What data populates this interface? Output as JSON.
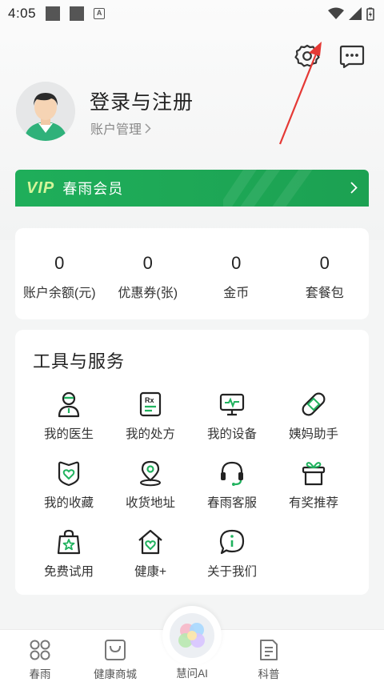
{
  "status_bar": {
    "time": "4:05"
  },
  "profile": {
    "login_title": "登录与注册",
    "account_link": "账户管理"
  },
  "vip": {
    "logo": "VIP",
    "label": "春雨会员"
  },
  "stats": [
    {
      "value": "0",
      "label": "账户余额(元)"
    },
    {
      "value": "0",
      "label": "优惠券(张)"
    },
    {
      "value": "0",
      "label": "金币"
    },
    {
      "value": "0",
      "label": "套餐包"
    }
  ],
  "tools": {
    "title": "工具与服务",
    "items": [
      {
        "label": "我的医生",
        "icon": "doctor-icon"
      },
      {
        "label": "我的处方",
        "icon": "prescription-icon"
      },
      {
        "label": "我的设备",
        "icon": "monitor-icon"
      },
      {
        "label": "姨妈助手",
        "icon": "bandage-icon"
      },
      {
        "label": "我的收藏",
        "icon": "favorites-icon"
      },
      {
        "label": "收货地址",
        "icon": "location-icon"
      },
      {
        "label": "春雨客服",
        "icon": "headset-icon"
      },
      {
        "label": "有奖推荐",
        "icon": "gift-icon"
      },
      {
        "label": "免费试用",
        "icon": "trial-bag-icon"
      },
      {
        "label": "健康+",
        "icon": "health-home-icon"
      },
      {
        "label": "关于我们",
        "icon": "info-icon"
      }
    ]
  },
  "nav": {
    "items": [
      {
        "label": "春雨",
        "icon": "home-grid-icon"
      },
      {
        "label": "健康商城",
        "icon": "shopping-bag-icon"
      },
      {
        "label": "慧问AI",
        "icon": "ai-orb-icon"
      },
      {
        "label": "科普",
        "icon": "article-icon"
      }
    ]
  },
  "colors": {
    "accent": "#1fae5a",
    "annotation_arrow": "#e53935",
    "icon_green": "#20b25e"
  }
}
